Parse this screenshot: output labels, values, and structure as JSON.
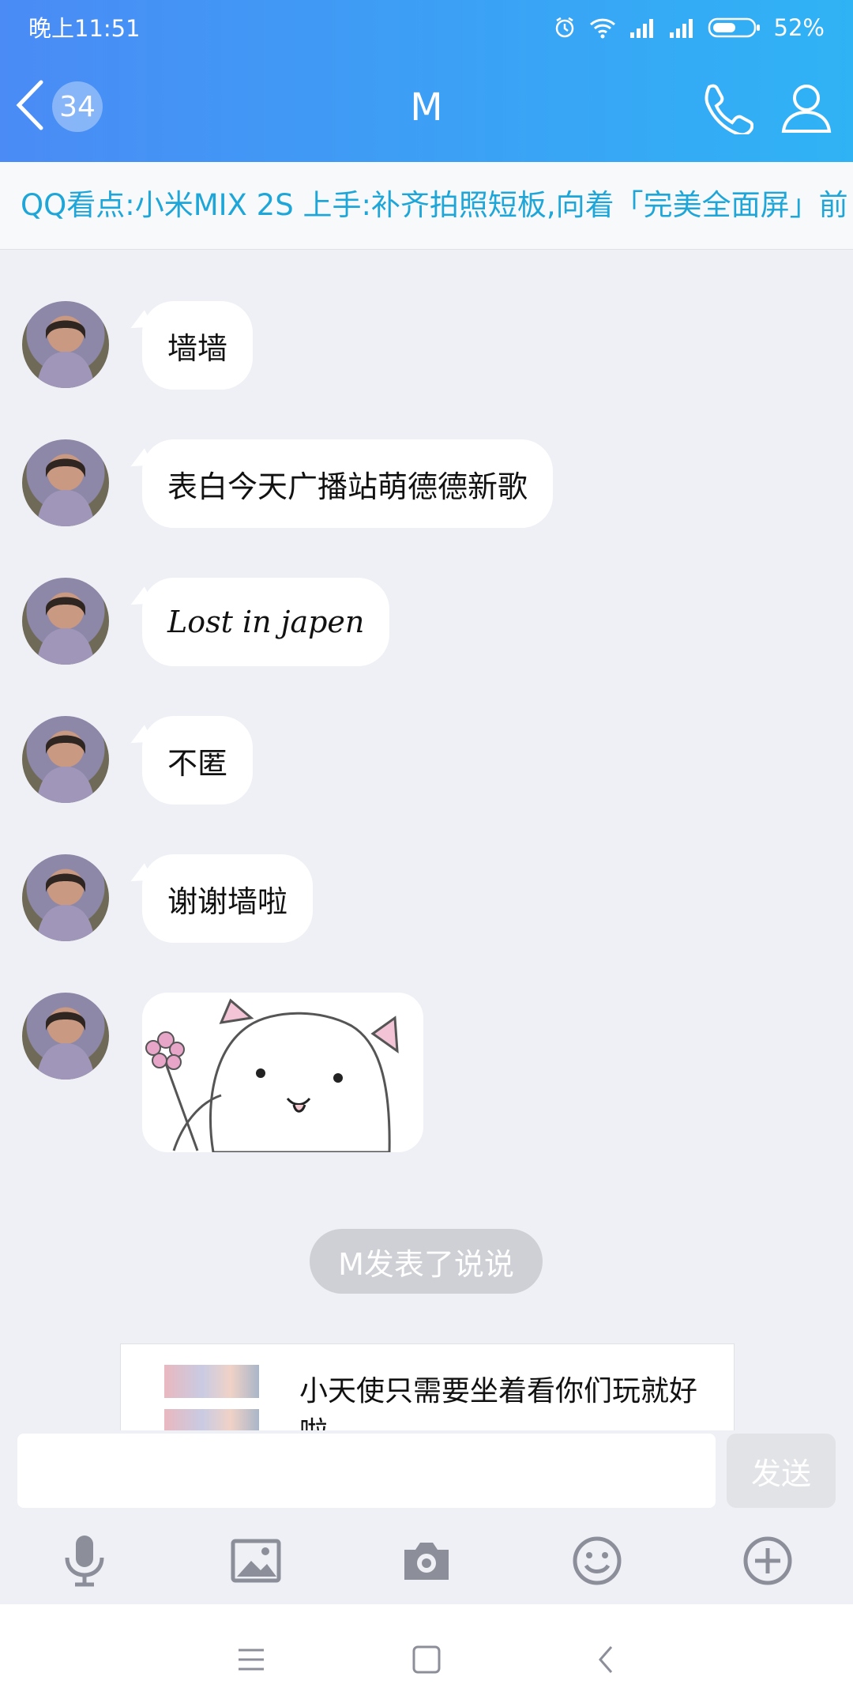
{
  "status": {
    "time": "晚上11:51",
    "battery": "52%"
  },
  "header": {
    "unread_count": "34",
    "title": "M"
  },
  "news": {
    "text": "QQ看点:小米MIX 2S 上手:补齐拍照短板,向着「完美全面屏」前"
  },
  "messages": [
    {
      "text": "墙墙"
    },
    {
      "text": "表白今天广播站萌德德新歌"
    },
    {
      "text": "Lost in japen"
    },
    {
      "text": "不匿"
    },
    {
      "text": "谢谢墙啦"
    }
  ],
  "system_notice": "M发表了说说",
  "shared_post": {
    "text": "小天使只需要坐着看你们玩就好啦"
  },
  "composer": {
    "send_label": "发送",
    "placeholder": ""
  },
  "toolbar": {
    "icons": [
      "microphone-icon",
      "image-icon",
      "camera-icon",
      "emoji-icon",
      "plus-icon"
    ]
  },
  "colors": {
    "header_start": "#4a8bf5",
    "header_end": "#2fb3f5",
    "news_text": "#1ea6d8",
    "chat_bg": "#eff0f5"
  }
}
